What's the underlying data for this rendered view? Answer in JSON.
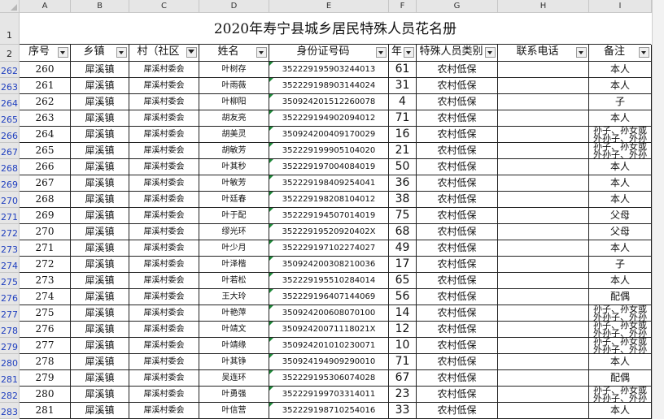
{
  "sheet": {
    "column_letters": [
      "A",
      "B",
      "C",
      "D",
      "E",
      "F",
      "G",
      "H",
      "I"
    ],
    "row1_label": "1",
    "row2_label": "2",
    "title": "2020年寿宁县城乡居民特殊人员花名册",
    "headers": [
      "序号",
      "乡镇",
      "村（社区",
      "姓名",
      "身份证号码",
      "年",
      "特殊人员类别",
      "联系电话",
      "备注"
    ],
    "filtered_column": "C",
    "rows": [
      {
        "row": "262",
        "no": "260",
        "town": "犀溪镇",
        "village": "犀溪村委会",
        "name": "叶树存",
        "id": "352229195903244013",
        "age": "61",
        "type": "农村低保",
        "phone": "",
        "note": "本人"
      },
      {
        "row": "263",
        "no": "261",
        "town": "犀溪镇",
        "village": "犀溪村委会",
        "name": "叶雨薇",
        "id": "352229198903144024",
        "age": "31",
        "type": "农村低保",
        "phone": "",
        "note": "本人"
      },
      {
        "row": "264",
        "no": "262",
        "town": "犀溪镇",
        "village": "犀溪村委会",
        "name": "叶柳阳",
        "id": "350924201512260078",
        "age": "4",
        "type": "农村低保",
        "phone": "",
        "note": "子"
      },
      {
        "row": "265",
        "no": "263",
        "town": "犀溪镇",
        "village": "犀溪村委会",
        "name": "胡友亮",
        "id": "352229194902094012",
        "age": "71",
        "type": "农村低保",
        "phone": "",
        "note": "本人"
      },
      {
        "row": "266",
        "no": "264",
        "town": "犀溪镇",
        "village": "犀溪村委会",
        "name": "胡美灵",
        "id": "350924200409170029",
        "age": "16",
        "type": "农村低保",
        "phone": "",
        "note": "孙子、孙女或外孙子、外孙"
      },
      {
        "row": "267",
        "no": "265",
        "town": "犀溪镇",
        "village": "犀溪村委会",
        "name": "胡敏芳",
        "id": "352229199905104020",
        "age": "21",
        "type": "农村低保",
        "phone": "",
        "note": "孙子、孙女或外孙子、外孙"
      },
      {
        "row": "268",
        "no": "266",
        "town": "犀溪镇",
        "village": "犀溪村委会",
        "name": "叶其秒",
        "id": "352229197004084019",
        "age": "50",
        "type": "农村低保",
        "phone": "",
        "note": "本人"
      },
      {
        "row": "269",
        "no": "267",
        "town": "犀溪镇",
        "village": "犀溪村委会",
        "name": "叶敏芳",
        "id": "352229198409254041",
        "age": "36",
        "type": "农村低保",
        "phone": "",
        "note": "本人"
      },
      {
        "row": "270",
        "no": "268",
        "town": "犀溪镇",
        "village": "犀溪村委会",
        "name": "叶廷春",
        "id": "352229198208104012",
        "age": "38",
        "type": "农村低保",
        "phone": "",
        "note": "本人"
      },
      {
        "row": "271",
        "no": "269",
        "town": "犀溪镇",
        "village": "犀溪村委会",
        "name": "叶于配",
        "id": "352229194507014019",
        "age": "75",
        "type": "农村低保",
        "phone": "",
        "note": "父母"
      },
      {
        "row": "272",
        "no": "270",
        "town": "犀溪镇",
        "village": "犀溪村委会",
        "name": "缪光环",
        "id": "35222919520920402X",
        "age": "68",
        "type": "农村低保",
        "phone": "",
        "note": "父母"
      },
      {
        "row": "273",
        "no": "271",
        "town": "犀溪镇",
        "village": "犀溪村委会",
        "name": "叶少月",
        "id": "352229197102274027",
        "age": "49",
        "type": "农村低保",
        "phone": "",
        "note": "本人"
      },
      {
        "row": "274",
        "no": "272",
        "town": "犀溪镇",
        "village": "犀溪村委会",
        "name": "叶泽楷",
        "id": "350924200308210036",
        "age": "17",
        "type": "农村低保",
        "phone": "",
        "note": "子"
      },
      {
        "row": "275",
        "no": "273",
        "town": "犀溪镇",
        "village": "犀溪村委会",
        "name": "叶若松",
        "id": "352229195510284014",
        "age": "65",
        "type": "农村低保",
        "phone": "",
        "note": "本人"
      },
      {
        "row": "276",
        "no": "274",
        "town": "犀溪镇",
        "village": "犀溪村委会",
        "name": "王大玲",
        "id": "352229196407144069",
        "age": "56",
        "type": "农村低保",
        "phone": "",
        "note": "配偶"
      },
      {
        "row": "277",
        "no": "275",
        "town": "犀溪镇",
        "village": "犀溪村委会",
        "name": "叶艳萍",
        "id": "350924200608070100",
        "age": "14",
        "type": "农村低保",
        "phone": "",
        "note": "孙子、孙女或外孙子、外孙"
      },
      {
        "row": "278",
        "no": "276",
        "town": "犀溪镇",
        "village": "犀溪村委会",
        "name": "叶靖文",
        "id": "35092420071118021X",
        "age": "12",
        "type": "农村低保",
        "phone": "",
        "note": "孙子、孙女或外孙子、外孙"
      },
      {
        "row": "279",
        "no": "277",
        "town": "犀溪镇",
        "village": "犀溪村委会",
        "name": "叶靖缘",
        "id": "350924201010230071",
        "age": "10",
        "type": "农村低保",
        "phone": "",
        "note": "孙子、孙女或外孙子、外孙"
      },
      {
        "row": "280",
        "no": "278",
        "town": "犀溪镇",
        "village": "犀溪村委会",
        "name": "叶其铮",
        "id": "350924194909290010",
        "age": "71",
        "type": "农村低保",
        "phone": "",
        "note": "本人"
      },
      {
        "row": "281",
        "no": "279",
        "town": "犀溪镇",
        "village": "犀溪村委会",
        "name": "吴连环",
        "id": "352229195306074028",
        "age": "67",
        "type": "农村低保",
        "phone": "",
        "note": "配偶"
      },
      {
        "row": "282",
        "no": "280",
        "town": "犀溪镇",
        "village": "犀溪村委会",
        "name": "叶勇强",
        "id": "352229199703314011",
        "age": "23",
        "type": "农村低保",
        "phone": "",
        "note": "孙子、孙女或外孙子、外孙"
      },
      {
        "row": "283",
        "no": "281",
        "town": "犀溪镇",
        "village": "犀溪村委会",
        "name": "叶信营",
        "id": "352229198710254016",
        "age": "33",
        "type": "农村低保",
        "phone": "",
        "note": "本人"
      }
    ]
  },
  "colors": {
    "header_gray": "#e6e6e6",
    "row_number_blue": "#1f3fbf",
    "grid_line": "#222222",
    "error_triangle_green": "#1f8a3a"
  }
}
